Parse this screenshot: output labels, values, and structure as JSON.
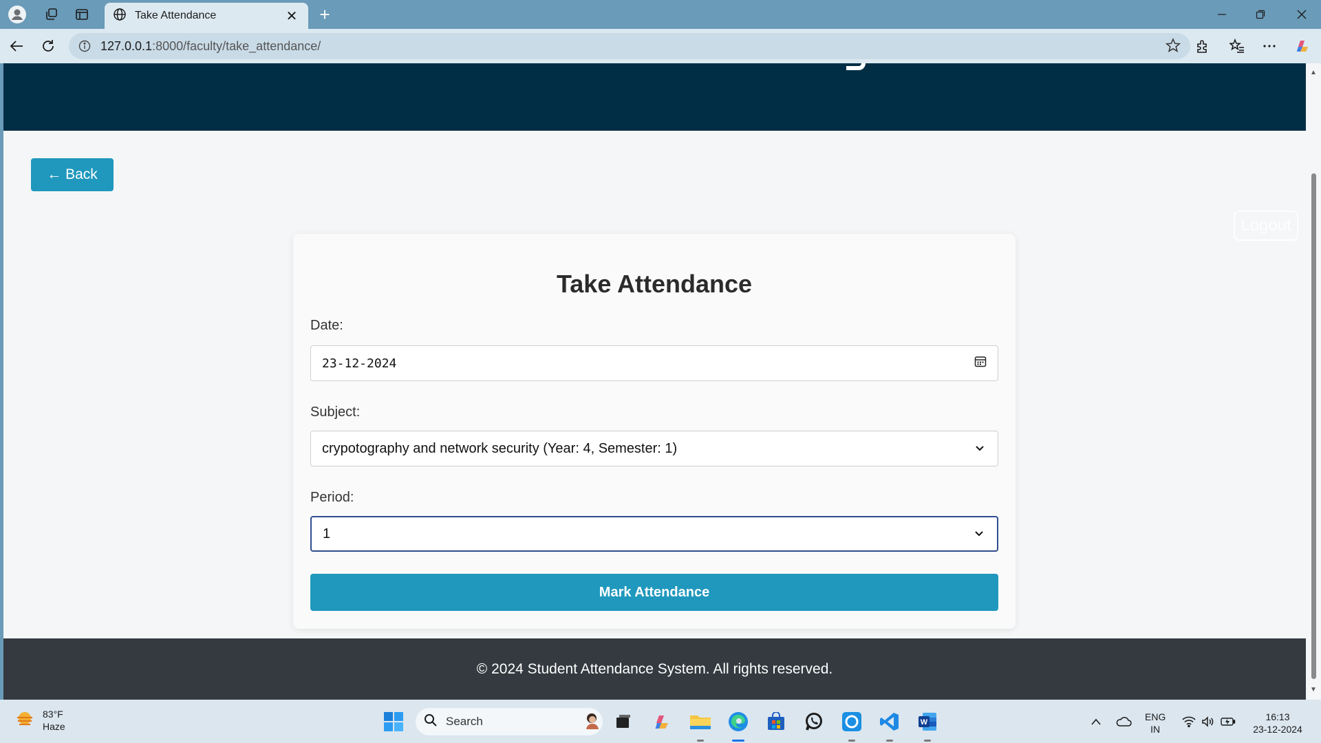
{
  "browser": {
    "tab_title": "Take Attendance",
    "tab_close": "✕",
    "new_tab": "+",
    "url_host": "127.0.0.1",
    "url_path": ":8000/faculty/take_attendance/"
  },
  "page": {
    "back_label": "← Back",
    "logout_label": "Logout",
    "form_title": "Take Attendance",
    "date_label": "Date:",
    "date_value": "23-12-2024",
    "subject_label": "Subject:",
    "subject_value": "crypotography and network security (Year: 4, Semester: 1)",
    "period_label": "Period:",
    "period_value": "1",
    "submit_label": "Mark Attendance",
    "footer_text": "© 2024 Student Attendance System. All rights reserved."
  },
  "colors": {
    "header": "#022e45",
    "accent": "#2098bd",
    "footer": "#343a40",
    "background": "#f4f6f7"
  },
  "taskbar": {
    "temperature": "83°F",
    "weather": "Haze",
    "search_placeholder": "Search",
    "lang_top": "ENG",
    "lang_bottom": "IN",
    "time": "16:13",
    "date": "23-12-2024"
  }
}
